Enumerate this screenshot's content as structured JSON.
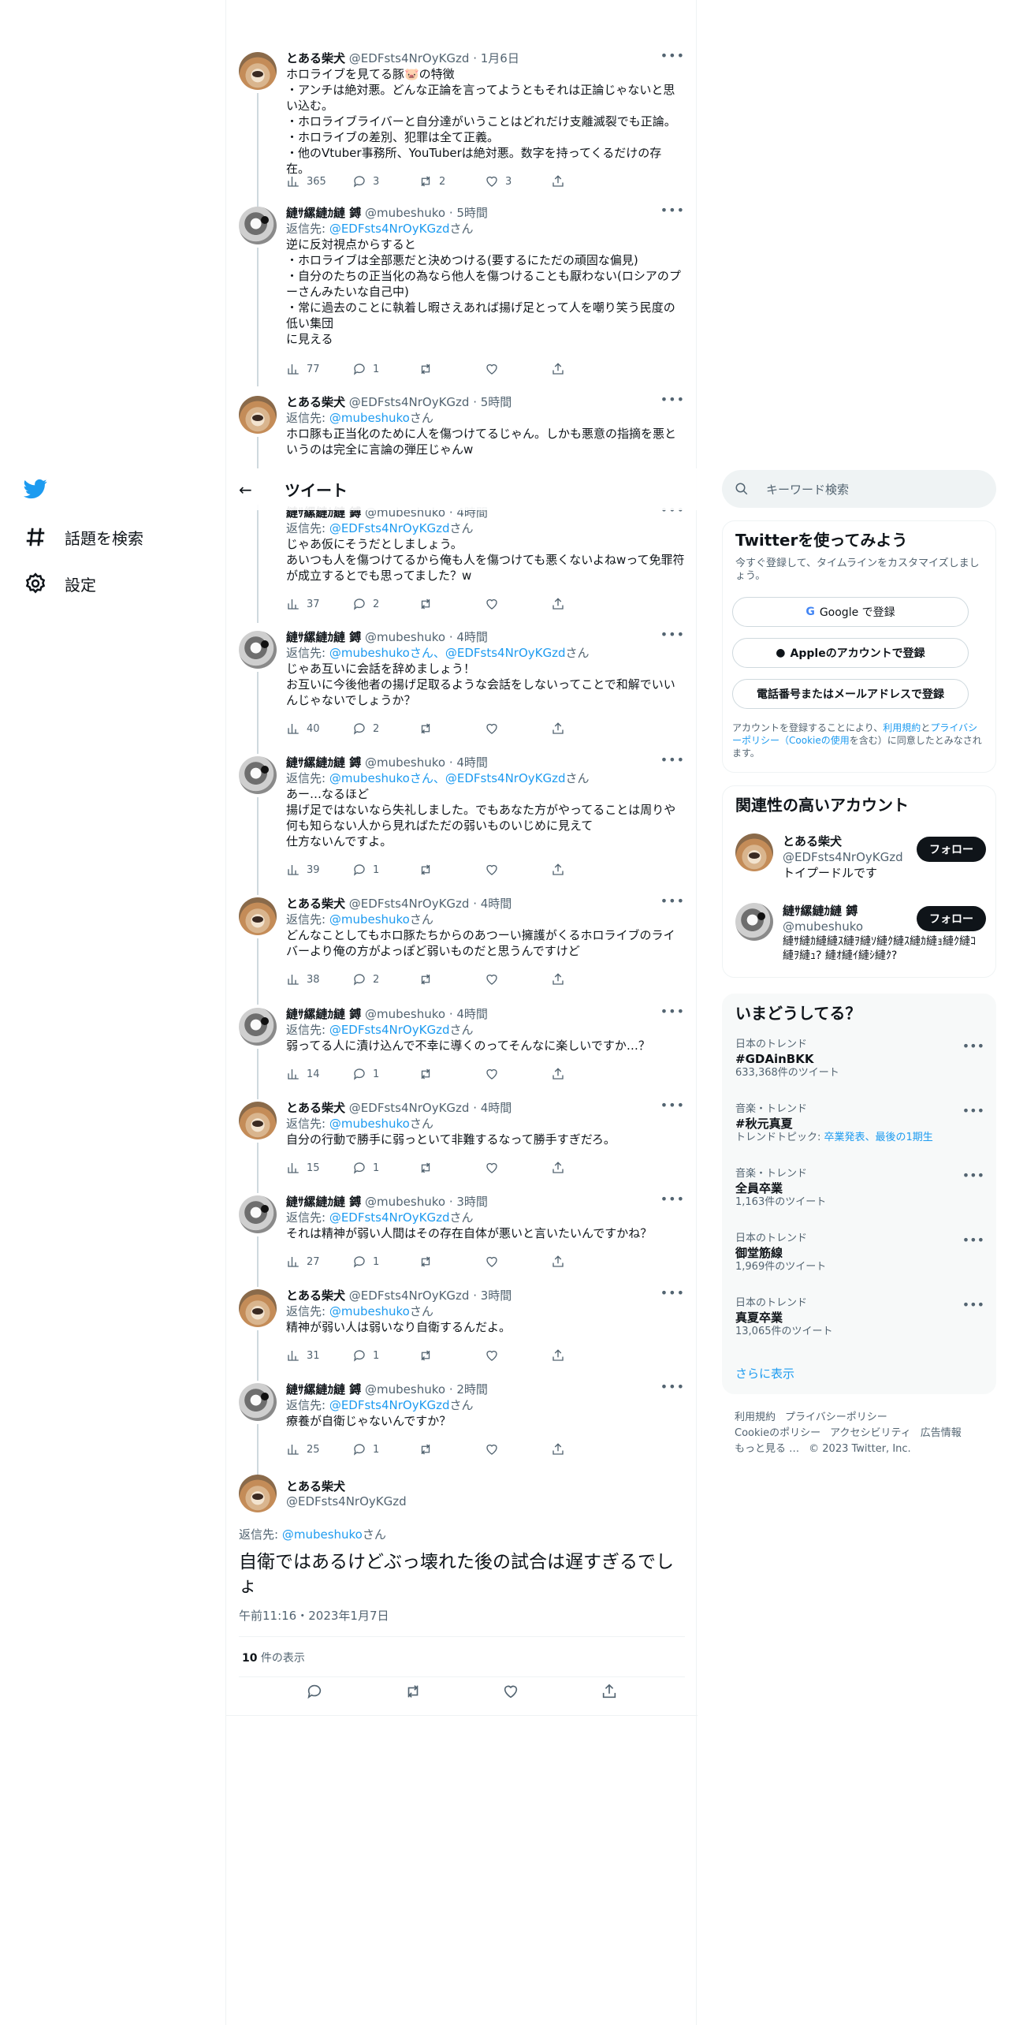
{
  "left_nav": {
    "items": [
      {
        "label": "話題を検索",
        "icon": "hashtag-icon"
      },
      {
        "label": "設定",
        "icon": "gear-icon"
      }
    ]
  },
  "header": {
    "back": "←",
    "title": "ツイート"
  },
  "tweets": [
    {
      "name": "とある柴犬",
      "handle": "@EDFsts4NrOyKGzd",
      "time": "1月6日",
      "reply_prefix": "",
      "reply_to": "",
      "reply_suffix": "",
      "text": "ホロライブを見てる豚🐷の特徴\n・アンチは絶対悪。どんな正論を言ってようともそれは正論じゃないと思い込む。\n・ホロライブライバーと自分達がいうことはどれだけ支離滅裂でも正論。\n・ホロライブの差別、犯罪は全て正義。\n・他のVtuber事務所、YouTuberは絶対悪。数字を持ってくるだけの存在。",
      "views": "365",
      "replies": "3",
      "retweets": "2",
      "likes": "3"
    },
    {
      "name": "縺ｻ縲縺ｶ縺 鎛",
      "handle": "@mubeshuko",
      "time": "5時間",
      "reply_prefix": "返信先: ",
      "reply_to": "@EDFsts4NrOyKGzd",
      "reply_suffix": "さん",
      "text": "逆に反対視点からすると\n・ホロライブは全部悪だと決めつける(要するにただの頑固な偏見)\n・自分のたちの正当化の為なら他人を傷つけることも厭わない(ロシアのプーさんみたいな自己中)\n・常に過去のことに執着し暇さえあれば揚げ足とって人を嘲り笑う民度の低い集団\nに見える",
      "views": "77",
      "replies": "1",
      "retweets": "",
      "likes": ""
    },
    {
      "name": "とある柴犬",
      "handle": "@EDFsts4NrOyKGzd",
      "time": "5時間",
      "reply_prefix": "返信先: ",
      "reply_to": "@mubeshuko",
      "reply_suffix": "さん",
      "text": "ホロ豚も正当化のために人を傷つけてるじゃん。しかも悪意の指摘を悪というのは完全に言論の弾圧じゃんw",
      "views": "",
      "replies": "",
      "retweets": "",
      "likes": ""
    },
    {
      "name": "縺ｻ縲縺ｶ縺 鎛",
      "handle": "@mubeshuko",
      "time": "4時間",
      "reply_prefix": "返信先: ",
      "reply_to": "@EDFsts4NrOyKGzd",
      "reply_suffix": "さん",
      "text": "じゃあ仮にそうだとしましょう。\nあいつも人を傷つけてるから俺も人を傷つけても悪くないよねwって免罪符が成立するとでも思ってました？w",
      "views": "37",
      "replies": "2",
      "retweets": "",
      "likes": ""
    },
    {
      "name": "縺ｻ縲縺ｶ縺 鎛",
      "handle": "@mubeshuko",
      "time": "4時間",
      "reply_prefix": "返信先: ",
      "reply_to": "@mubeshukoさん、@EDFsts4NrOyKGzd",
      "reply_suffix": "さん",
      "text": "じゃあ互いに会話を辞めましょう！\nお互いに今後他者の揚げ足取るような会話をしないってことで和解でいいんじゃないでしょうか？",
      "views": "40",
      "replies": "2",
      "retweets": "",
      "likes": ""
    },
    {
      "name": "縺ｻ縲縺ｶ縺 鎛",
      "handle": "@mubeshuko",
      "time": "4時間",
      "reply_prefix": "返信先: ",
      "reply_to": "@mubeshukoさん、@EDFsts4NrOyKGzd",
      "reply_suffix": "さん",
      "text": "あー…なるほど\n揚げ足ではないなら失礼しました。でもあなた方がやってることは周りや何も知らない人から見ればただの弱いものいじめに見えて\n仕方ないんですよ。",
      "views": "39",
      "replies": "1",
      "retweets": "",
      "likes": ""
    },
    {
      "name": "とある柴犬",
      "handle": "@EDFsts4NrOyKGzd",
      "time": "4時間",
      "reply_prefix": "返信先: ",
      "reply_to": "@mubeshuko",
      "reply_suffix": "さん",
      "text": "どんなことしてもホロ豚たちからのあつーい擁護がくるホロライブのライバーより俺の方がよっぽど弱いものだと思うんですけど",
      "views": "38",
      "replies": "2",
      "retweets": "",
      "likes": ""
    },
    {
      "name": "縺ｻ縲縺ｶ縺 鎛",
      "handle": "@mubeshuko",
      "time": "4時間",
      "reply_prefix": "返信先: ",
      "reply_to": "@EDFsts4NrOyKGzd",
      "reply_suffix": "さん",
      "text": "弱ってる人に漬け込んで不幸に導くのってそんなに楽しいですか…？",
      "views": "14",
      "replies": "1",
      "retweets": "",
      "likes": ""
    },
    {
      "name": "とある柴犬",
      "handle": "@EDFsts4NrOyKGzd",
      "time": "4時間",
      "reply_prefix": "返信先: ",
      "reply_to": "@mubeshuko",
      "reply_suffix": "さん",
      "text": "自分の行動で勝手に弱っといて非難するなって勝手すぎだろ。",
      "views": "15",
      "replies": "1",
      "retweets": "",
      "likes": ""
    },
    {
      "name": "縺ｻ縲縺ｶ縺 鎛",
      "handle": "@mubeshuko",
      "time": "3時間",
      "reply_prefix": "返信先: ",
      "reply_to": "@EDFsts4NrOyKGzd",
      "reply_suffix": "さん",
      "text": "それは精神が弱い人間はその存在自体が悪いと言いたいんですかね？",
      "views": "27",
      "replies": "1",
      "retweets": "",
      "likes": ""
    },
    {
      "name": "とある柴犬",
      "handle": "@EDFsts4NrOyKGzd",
      "time": "3時間",
      "reply_prefix": "返信先: ",
      "reply_to": "@mubeshuko",
      "reply_suffix": "さん",
      "text": "精神が弱い人は弱いなり自衛するんだよ。",
      "views": "31",
      "replies": "1",
      "retweets": "",
      "likes": ""
    },
    {
      "name": "縺ｻ縲縺ｶ縺 鎛",
      "handle": "@mubeshuko",
      "time": "2時間",
      "reply_prefix": "返信先: ",
      "reply_to": "@EDFsts4NrOyKGzd",
      "reply_suffix": "さん",
      "text": "療養が自衛じゃないんですか？",
      "views": "25",
      "replies": "1",
      "retweets": "",
      "likes": ""
    }
  ],
  "focus": {
    "name": "とある柴犬",
    "handle": "@EDFsts4NrOyKGzd",
    "reply_prefix": "返信先: ",
    "reply_to": "@mubeshuko",
    "reply_suffix": "さん",
    "text": "自衛ではあるけどぶっ壊れた後の試合は遅すぎるでしょ",
    "timestamp": "午前11:16・2023年1月7日",
    "views_count": "10",
    "views_label": " 件の表示"
  },
  "search": {
    "placeholder": "キーワード検索"
  },
  "signup": {
    "title": "Twitterを使ってみよう",
    "subtitle": "今すぐ登録して、タイムラインをカスタマイズしましょう。",
    "google": "Google で登録",
    "apple": "Appleのアカウントで登録",
    "phone": "電話番号またはメールアドレスで登録",
    "legal_1": "アカウントを登録することにより、",
    "legal_terms": "利用規約",
    "legal_2": "と",
    "legal_privacy": "プライバシーポリシー（Cookieの使用",
    "legal_3": "を含む）に同意したとみなされます。"
  },
  "related": {
    "title": "関連性の高いアカウント",
    "follow_label": "フォロー",
    "accounts": [
      {
        "name": "とある柴犬",
        "handle": "@EDFsts4NrOyKGzd",
        "bio": "トイプードルです"
      },
      {
        "name": "縺ｻ縲縺ｶ縺 鎛",
        "handle": "@mubeshuko",
        "bio": "縺ｻ縺ｶ縺縺ｽ縺ｦ縺ｿ縺ｸ縺ｽ縺ｶ縺ｮ縺ｸ縺ｺ縺ｦ縺ｭ? 縺ｵ縺ｲ縺ｼ縺ｸ?"
      }
    ]
  },
  "trends": {
    "title": "いまどうしてる？",
    "items": [
      {
        "meta": "日本のトレンド",
        "name": "#GDAinBKK",
        "count": "633,368件のツイート",
        "topic_label": "",
        "topic_links": ""
      },
      {
        "meta": "音楽・トレンド",
        "name": "#秋元真夏",
        "count": "",
        "topic_label": "トレンドトピック: ",
        "topic_links": "卒業発表、最後の1期生"
      },
      {
        "meta": "音楽・トレンド",
        "name": "全員卒業",
        "count": "1,163件のツイート",
        "topic_label": "",
        "topic_links": ""
      },
      {
        "meta": "日本のトレンド",
        "name": "御堂筋線",
        "count": "1,969件のツイート",
        "topic_label": "",
        "topic_links": ""
      },
      {
        "meta": "日本のトレンド",
        "name": "真夏卒業",
        "count": "13,065件のツイート",
        "topic_label": "",
        "topic_links": ""
      }
    ],
    "show_more": "さらに表示"
  },
  "footer": {
    "links": [
      "利用規約",
      "プライバシーポリシー",
      "Cookieのポリシー",
      "アクセシビリティ",
      "広告情報",
      "もっと見る …"
    ],
    "copyright": "© 2023 Twitter, Inc."
  },
  "colors": {
    "accent": "#1d9bf0",
    "text": "#0f1419",
    "secondary": "#536471",
    "border": "#eff3f4"
  }
}
